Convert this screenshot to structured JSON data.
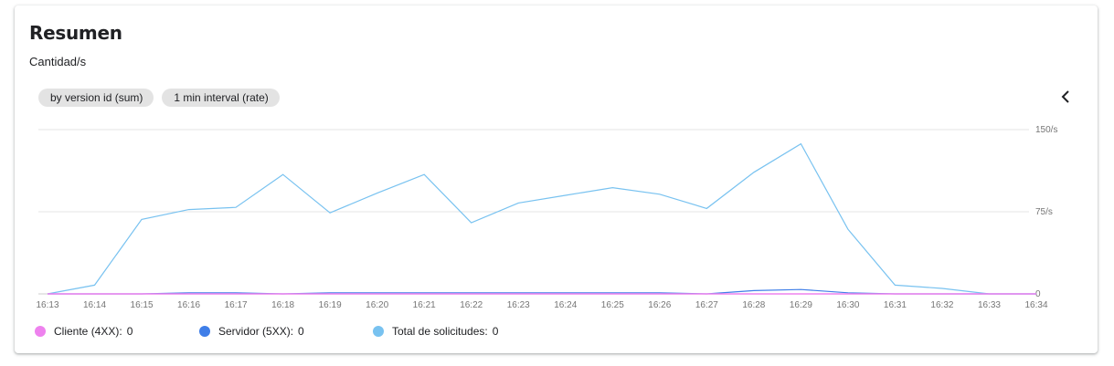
{
  "panel": {
    "title": "Resumen",
    "subtitle": "Cantidad/s",
    "chips": [
      "by version id (sum)",
      "1 min interval (rate)"
    ],
    "collapse_icon": "chevron-left-icon"
  },
  "chart_data": {
    "type": "line",
    "x": [
      "16:13",
      "16:14",
      "16:15",
      "16:16",
      "16:17",
      "16:18",
      "16:19",
      "16:20",
      "16:21",
      "16:22",
      "16:23",
      "16:24",
      "16:25",
      "16:26",
      "16:27",
      "16:28",
      "16:29",
      "16:30",
      "16:31",
      "16:32",
      "16:33",
      "16:34"
    ],
    "y_ticks": [
      {
        "value": 150,
        "label": "150/s"
      },
      {
        "value": 75,
        "label": "75/s"
      },
      {
        "value": 0,
        "label": "0"
      }
    ],
    "ylim": [
      0,
      150
    ],
    "grid": true,
    "legend_position": "bottom",
    "series": [
      {
        "name": "Total de solicitudes",
        "color": "#78c2f0",
        "values": [
          0,
          8,
          68,
          77,
          79,
          109,
          74,
          92,
          109,
          65,
          83,
          90,
          97,
          91,
          78,
          111,
          137,
          59,
          8,
          5,
          0,
          0
        ]
      },
      {
        "name": "Servidor (5XX)",
        "color": "#3f7ee8",
        "values": [
          0,
          0,
          0,
          1,
          1,
          0,
          1,
          1,
          1,
          1,
          1,
          1,
          1,
          1,
          0,
          3,
          4,
          1,
          0,
          0,
          0,
          0
        ]
      },
      {
        "name": "Cliente (4XX)",
        "color": "#ee82ee",
        "values": [
          0,
          0,
          0,
          0,
          0,
          0,
          0,
          0,
          0,
          0,
          0,
          0,
          0,
          0,
          0,
          0,
          0,
          0,
          0,
          0,
          0,
          0
        ]
      }
    ]
  },
  "legend": [
    {
      "label": "Cliente (4XX):",
      "value": "0",
      "color": "#ee82ee"
    },
    {
      "label": "Servidor (5XX):",
      "value": "0",
      "color": "#3f7ee8"
    },
    {
      "label": "Total de solicitudes:",
      "value": "0",
      "color": "#78c2f0"
    }
  ]
}
